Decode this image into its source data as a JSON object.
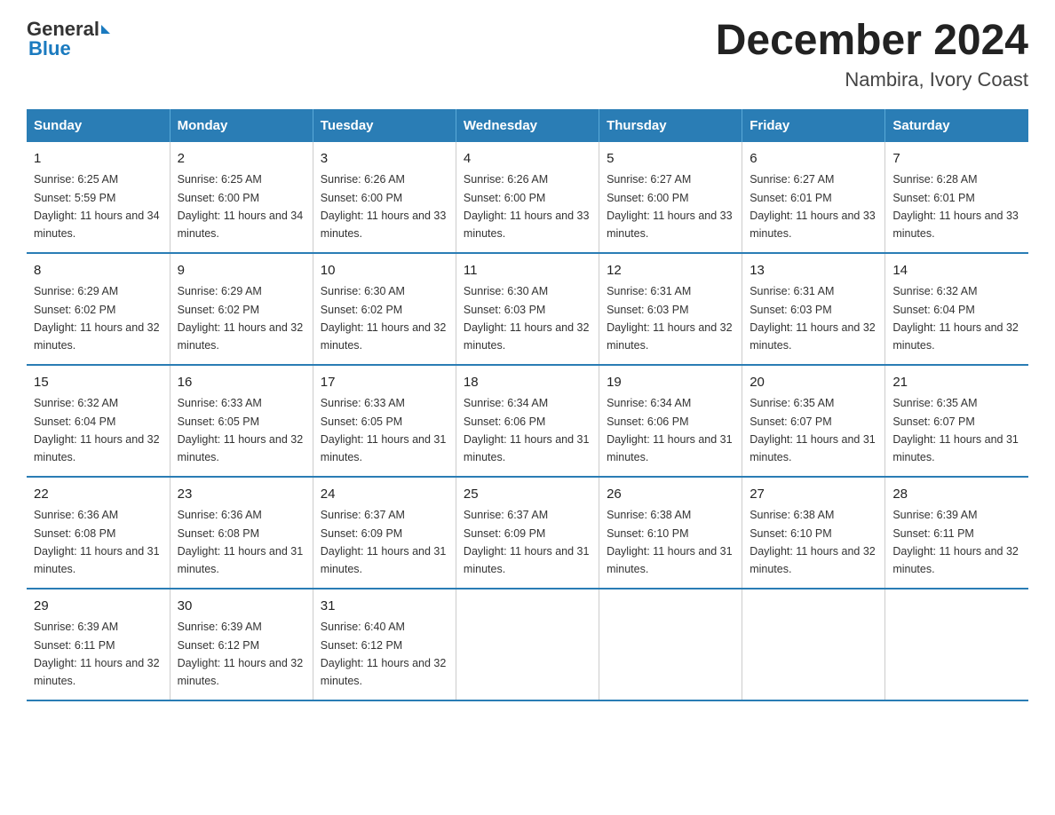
{
  "logo": {
    "general": "General",
    "blue": "Blue"
  },
  "title": "December 2024",
  "subtitle": "Nambira, Ivory Coast",
  "days_header": [
    "Sunday",
    "Monday",
    "Tuesday",
    "Wednesday",
    "Thursday",
    "Friday",
    "Saturday"
  ],
  "weeks": [
    [
      {
        "day": "1",
        "sunrise": "Sunrise: 6:25 AM",
        "sunset": "Sunset: 5:59 PM",
        "daylight": "Daylight: 11 hours and 34 minutes."
      },
      {
        "day": "2",
        "sunrise": "Sunrise: 6:25 AM",
        "sunset": "Sunset: 6:00 PM",
        "daylight": "Daylight: 11 hours and 34 minutes."
      },
      {
        "day": "3",
        "sunrise": "Sunrise: 6:26 AM",
        "sunset": "Sunset: 6:00 PM",
        "daylight": "Daylight: 11 hours and 33 minutes."
      },
      {
        "day": "4",
        "sunrise": "Sunrise: 6:26 AM",
        "sunset": "Sunset: 6:00 PM",
        "daylight": "Daylight: 11 hours and 33 minutes."
      },
      {
        "day": "5",
        "sunrise": "Sunrise: 6:27 AM",
        "sunset": "Sunset: 6:00 PM",
        "daylight": "Daylight: 11 hours and 33 minutes."
      },
      {
        "day": "6",
        "sunrise": "Sunrise: 6:27 AM",
        "sunset": "Sunset: 6:01 PM",
        "daylight": "Daylight: 11 hours and 33 minutes."
      },
      {
        "day": "7",
        "sunrise": "Sunrise: 6:28 AM",
        "sunset": "Sunset: 6:01 PM",
        "daylight": "Daylight: 11 hours and 33 minutes."
      }
    ],
    [
      {
        "day": "8",
        "sunrise": "Sunrise: 6:29 AM",
        "sunset": "Sunset: 6:02 PM",
        "daylight": "Daylight: 11 hours and 32 minutes."
      },
      {
        "day": "9",
        "sunrise": "Sunrise: 6:29 AM",
        "sunset": "Sunset: 6:02 PM",
        "daylight": "Daylight: 11 hours and 32 minutes."
      },
      {
        "day": "10",
        "sunrise": "Sunrise: 6:30 AM",
        "sunset": "Sunset: 6:02 PM",
        "daylight": "Daylight: 11 hours and 32 minutes."
      },
      {
        "day": "11",
        "sunrise": "Sunrise: 6:30 AM",
        "sunset": "Sunset: 6:03 PM",
        "daylight": "Daylight: 11 hours and 32 minutes."
      },
      {
        "day": "12",
        "sunrise": "Sunrise: 6:31 AM",
        "sunset": "Sunset: 6:03 PM",
        "daylight": "Daylight: 11 hours and 32 minutes."
      },
      {
        "day": "13",
        "sunrise": "Sunrise: 6:31 AM",
        "sunset": "Sunset: 6:03 PM",
        "daylight": "Daylight: 11 hours and 32 minutes."
      },
      {
        "day": "14",
        "sunrise": "Sunrise: 6:32 AM",
        "sunset": "Sunset: 6:04 PM",
        "daylight": "Daylight: 11 hours and 32 minutes."
      }
    ],
    [
      {
        "day": "15",
        "sunrise": "Sunrise: 6:32 AM",
        "sunset": "Sunset: 6:04 PM",
        "daylight": "Daylight: 11 hours and 32 minutes."
      },
      {
        "day": "16",
        "sunrise": "Sunrise: 6:33 AM",
        "sunset": "Sunset: 6:05 PM",
        "daylight": "Daylight: 11 hours and 32 minutes."
      },
      {
        "day": "17",
        "sunrise": "Sunrise: 6:33 AM",
        "sunset": "Sunset: 6:05 PM",
        "daylight": "Daylight: 11 hours and 31 minutes."
      },
      {
        "day": "18",
        "sunrise": "Sunrise: 6:34 AM",
        "sunset": "Sunset: 6:06 PM",
        "daylight": "Daylight: 11 hours and 31 minutes."
      },
      {
        "day": "19",
        "sunrise": "Sunrise: 6:34 AM",
        "sunset": "Sunset: 6:06 PM",
        "daylight": "Daylight: 11 hours and 31 minutes."
      },
      {
        "day": "20",
        "sunrise": "Sunrise: 6:35 AM",
        "sunset": "Sunset: 6:07 PM",
        "daylight": "Daylight: 11 hours and 31 minutes."
      },
      {
        "day": "21",
        "sunrise": "Sunrise: 6:35 AM",
        "sunset": "Sunset: 6:07 PM",
        "daylight": "Daylight: 11 hours and 31 minutes."
      }
    ],
    [
      {
        "day": "22",
        "sunrise": "Sunrise: 6:36 AM",
        "sunset": "Sunset: 6:08 PM",
        "daylight": "Daylight: 11 hours and 31 minutes."
      },
      {
        "day": "23",
        "sunrise": "Sunrise: 6:36 AM",
        "sunset": "Sunset: 6:08 PM",
        "daylight": "Daylight: 11 hours and 31 minutes."
      },
      {
        "day": "24",
        "sunrise": "Sunrise: 6:37 AM",
        "sunset": "Sunset: 6:09 PM",
        "daylight": "Daylight: 11 hours and 31 minutes."
      },
      {
        "day": "25",
        "sunrise": "Sunrise: 6:37 AM",
        "sunset": "Sunset: 6:09 PM",
        "daylight": "Daylight: 11 hours and 31 minutes."
      },
      {
        "day": "26",
        "sunrise": "Sunrise: 6:38 AM",
        "sunset": "Sunset: 6:10 PM",
        "daylight": "Daylight: 11 hours and 31 minutes."
      },
      {
        "day": "27",
        "sunrise": "Sunrise: 6:38 AM",
        "sunset": "Sunset: 6:10 PM",
        "daylight": "Daylight: 11 hours and 32 minutes."
      },
      {
        "day": "28",
        "sunrise": "Sunrise: 6:39 AM",
        "sunset": "Sunset: 6:11 PM",
        "daylight": "Daylight: 11 hours and 32 minutes."
      }
    ],
    [
      {
        "day": "29",
        "sunrise": "Sunrise: 6:39 AM",
        "sunset": "Sunset: 6:11 PM",
        "daylight": "Daylight: 11 hours and 32 minutes."
      },
      {
        "day": "30",
        "sunrise": "Sunrise: 6:39 AM",
        "sunset": "Sunset: 6:12 PM",
        "daylight": "Daylight: 11 hours and 32 minutes."
      },
      {
        "day": "31",
        "sunrise": "Sunrise: 6:40 AM",
        "sunset": "Sunset: 6:12 PM",
        "daylight": "Daylight: 11 hours and 32 minutes."
      },
      {
        "day": "",
        "sunrise": "",
        "sunset": "",
        "daylight": ""
      },
      {
        "day": "",
        "sunrise": "",
        "sunset": "",
        "daylight": ""
      },
      {
        "day": "",
        "sunrise": "",
        "sunset": "",
        "daylight": ""
      },
      {
        "day": "",
        "sunrise": "",
        "sunset": "",
        "daylight": ""
      }
    ]
  ]
}
